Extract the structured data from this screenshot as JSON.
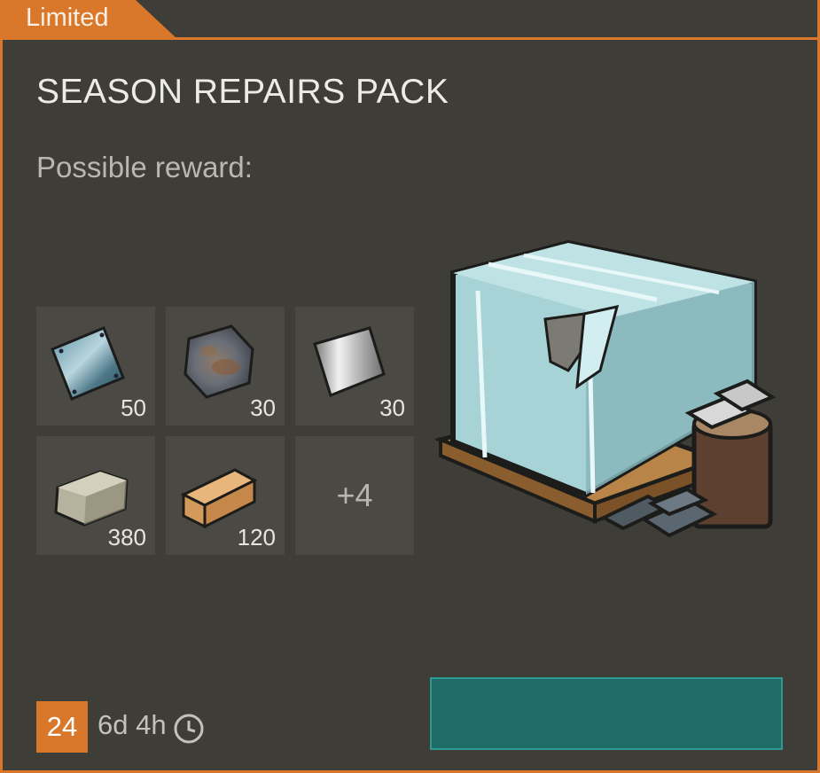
{
  "tag": {
    "label": "Limited"
  },
  "pack": {
    "title": "SEASON REPAIRS PACK",
    "subtitle": "Possible reward:"
  },
  "rewards": [
    {
      "icon": "metal-sheet-icon",
      "qty": "50"
    },
    {
      "icon": "rusty-metal-plate-icon",
      "qty": "30"
    },
    {
      "icon": "steel-sheet-icon",
      "qty": "30"
    },
    {
      "icon": "stone-block-icon",
      "qty": "380"
    },
    {
      "icon": "wood-plank-icon",
      "qty": "120"
    }
  ],
  "more_rewards": "+4",
  "hero_icon": "supply-crate-icon",
  "footer": {
    "level": "24",
    "time_left": "6d 4h",
    "clock_icon": "clock-icon"
  },
  "colors": {
    "accent": "#d9782a",
    "button": "#1f6b68",
    "panel": "#3e3d38"
  }
}
